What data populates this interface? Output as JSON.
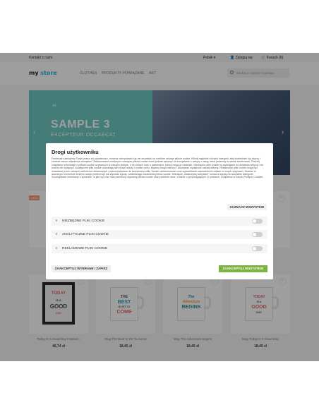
{
  "topbar": {
    "contact": "Kontakt z nami",
    "language": "Polski ▾",
    "login": "Zaloguj się",
    "cart": "Koszyk (0)"
  },
  "header": {
    "logo_prefix": "my",
    "logo_suffix": " store",
    "nav": [
      "CLOTHES",
      "PRODUKTY POWIĄZANE",
      "ART"
    ],
    "search_placeholder": "Szukaj w naszym katalogu"
  },
  "slider": {
    "quote": "“",
    "title": "SAMPLE 3",
    "subtitle": "EXCEPTEUR OCCAECAT",
    "prev": "‹",
    "next": "›"
  },
  "row1": {
    "badge": "-20%"
  },
  "products": [
    {
      "name": "Today Is A Good Day Framed...",
      "price": "46,74 zł",
      "lines": [
        "TODAY",
        "IS A",
        "GOOD",
        "DAY"
      ]
    },
    {
      "name": "Mug The Best Is Yet To Come",
      "price": "18,45 zł",
      "lines": [
        "THE",
        "BEST",
        "IS YET TO",
        "COME"
      ]
    },
    {
      "name": "Mug The Adventure Begins",
      "price": "18,45 zł",
      "lines": [
        "The",
        "Adventure",
        "BEGINS"
      ]
    },
    {
      "name": "Mug Today Is A Good Day",
      "price": "18,45 zł",
      "lines": [
        "TODAY",
        "IS A",
        "GOOD",
        "DAY"
      ]
    }
  ],
  "modal": {
    "title": "Drogi użytkowniku",
    "text": "Ponieważ szanujemy Twoje prawo do prywatności, możesz zdecydować się nie zezwalać na niektóre rodzaje plików cookie. Kliknij nagłówki różnych kategorii, aby dowiedzieć się więcej i zmienić nasze ustawienia domyślne. Zablokowanie niektórych rodzajów plików cookie może jednak wpłynąć na korzystanie z witryny i usług, które jesteśmy w stanie zaoferować. Poniżej znajdziesz informacje o plikach cookie używanych w naszym sklepie, o ich celach oraz o partnerach, którzy mogą je ustawiać. Niezbędne pliki cookie są wymagane do działania witryny i nie można ich wyłączyć. Analityczne pliki cookie pozwalają nam liczyć wizyty i źródła ruchu, abyśmy mogli mierzyć i poprawiać wydajność naszej witryny. Reklamowe pliki cookie mogą być ustawiane przez naszych partnerów reklamowych i wykorzystywane do tworzenia profilu Twoich zainteresowań oraz wyświetlania odpowiednich reklam w innych witrynach. Możesz w dowolnym momencie zmienić swoje preferencje lub wycofać zgodę, odwiedzając ustawienia plików cookie. Kliknięcie „Zaakceptuj wszystkie” oznacza zgodę na wszystkie kategorie. Szczegółowe informacje o sposobie, w jaki my oraz nasi partnerzy używamy plików cookie oraz podobne dane, a także o przysługujących Ci prawach, znajdziesz w naszej Polityce Cookies.",
    "select_all": "ZAZNACZ WSZYSTKIE",
    "sections": [
      "NIEZBĘDNE PLIKI COOKIE",
      "ANALITYCZNE PLIKI COOKIE",
      "REKLAMOWE PLIKI COOKIE"
    ],
    "accept_selected": "ZAAKCEPTUJ WYBRANE I ZAPISZ",
    "accept_all": "ZAAKCEPTUJ WSZYSTKIE"
  },
  "colors": {
    "accent": "#24b9d7",
    "accept_button": "#7cb342",
    "badge": "#f39d72",
    "slider_bg": "#6ec9c2"
  }
}
